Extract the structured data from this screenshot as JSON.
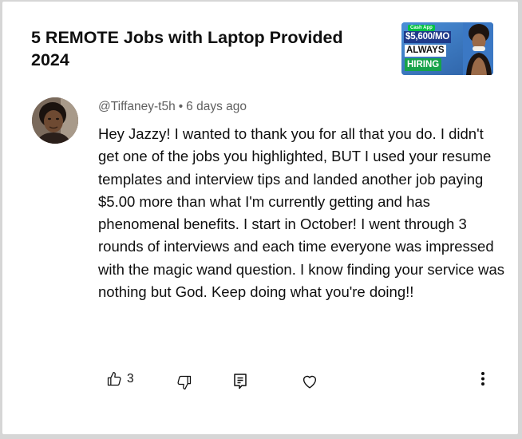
{
  "video": {
    "title": "5 REMOTE Jobs with Laptop Provided 2024",
    "thumbnail": {
      "badge": "Cash App",
      "salary": "$5,600/MO",
      "always": "ALWAYS",
      "hiring": "HIRING"
    }
  },
  "comment": {
    "author": "@Tiffaney-t5h",
    "separator": "•",
    "time": "6 days ago",
    "text": "Hey Jazzy! I wanted to thank you for all that you do. I didn't get one of the jobs you highlighted, BUT I used your resume templates and interview tips and landed another job paying $5.00 more than what I'm currently getting and has phenomenal benefits. I start in October! I went through 3 rounds of interviews and each time everyone was impressed with the magic wand question. I know finding your service was nothing but God. Keep doing what you're doing!!",
    "like_count": "3"
  },
  "icons": {
    "like": "thumbs-up-icon",
    "dislike": "thumbs-down-icon",
    "reply": "reply-icon",
    "heart": "heart-icon",
    "more": "more-vertical-icon"
  },
  "colors": {
    "meta_text": "#606060",
    "body_text": "#0f0f0f",
    "hiring_green": "#16a34a",
    "salary_blue": "#1e3a8a"
  }
}
